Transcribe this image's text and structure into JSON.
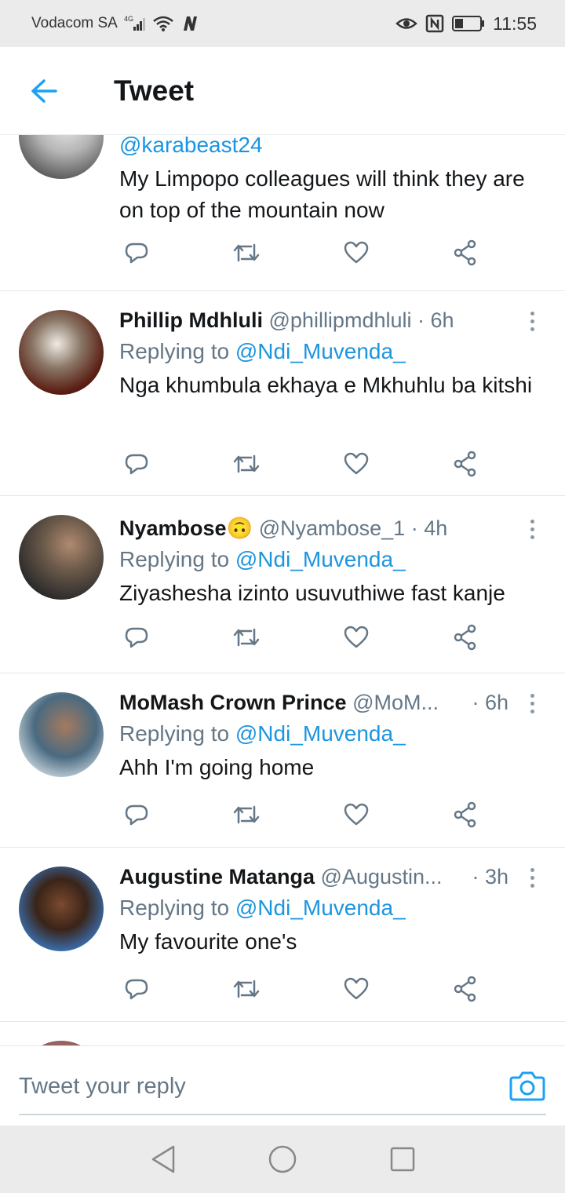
{
  "status_bar": {
    "carrier": "Vodacom SA",
    "network": "4G",
    "time": "11:55",
    "icons": [
      "signal-icon",
      "wifi-icon",
      "n-app-icon",
      "eye-icon",
      "nfc-icon",
      "battery-icon"
    ]
  },
  "header": {
    "title": "Tweet",
    "back_icon": "arrow-left-icon"
  },
  "tweets": [
    {
      "name": "",
      "handle": "",
      "time": "",
      "replying_label": "",
      "replying_to": "@karabeast24",
      "text": "My Limpopo colleagues will think they are on top of the mountain now"
    },
    {
      "name": "Phillip Mdhluli",
      "handle": "@phillipmdhluli",
      "time": "6h",
      "replying_label": "Replying to ",
      "replying_to": "@Ndi_Muvenda_",
      "text": "Nga khumbula ekhaya e Mkhuhlu ba kitshi"
    },
    {
      "name": "Nyambose🙃",
      "handle": "@Nyambose_1",
      "time": "4h",
      "replying_label": "Replying to ",
      "replying_to": "@Ndi_Muvenda_",
      "text": "Ziyashesha izinto usuvuthiwe fast kanje"
    },
    {
      "name": "MoMash Crown Prince",
      "handle": "@MoM...",
      "time": "6h",
      "replying_label": "Replying to ",
      "replying_to": "@Ndi_Muvenda_",
      "text": "Ahh I'm going home"
    },
    {
      "name": "Augustine Matanga",
      "handle": "@Augustin...",
      "time": "3h",
      "replying_label": "Replying to ",
      "replying_to": "@Ndi_Muvenda_",
      "text": "My favourite one's"
    }
  ],
  "action_icons": [
    "reply-icon",
    "retweet-icon",
    "like-icon",
    "share-icon"
  ],
  "composer": {
    "placeholder": "Tweet your reply",
    "camera_icon": "camera-icon"
  },
  "nav_bar": {
    "icons": [
      "back-triangle-icon",
      "home-circle-icon",
      "recents-square-icon"
    ]
  },
  "colors": {
    "accent": "#1da1f2",
    "mention": "#1b95e0",
    "secondary_text": "#657786",
    "primary_text": "#14171a",
    "system_bar": "#ebebeb"
  }
}
